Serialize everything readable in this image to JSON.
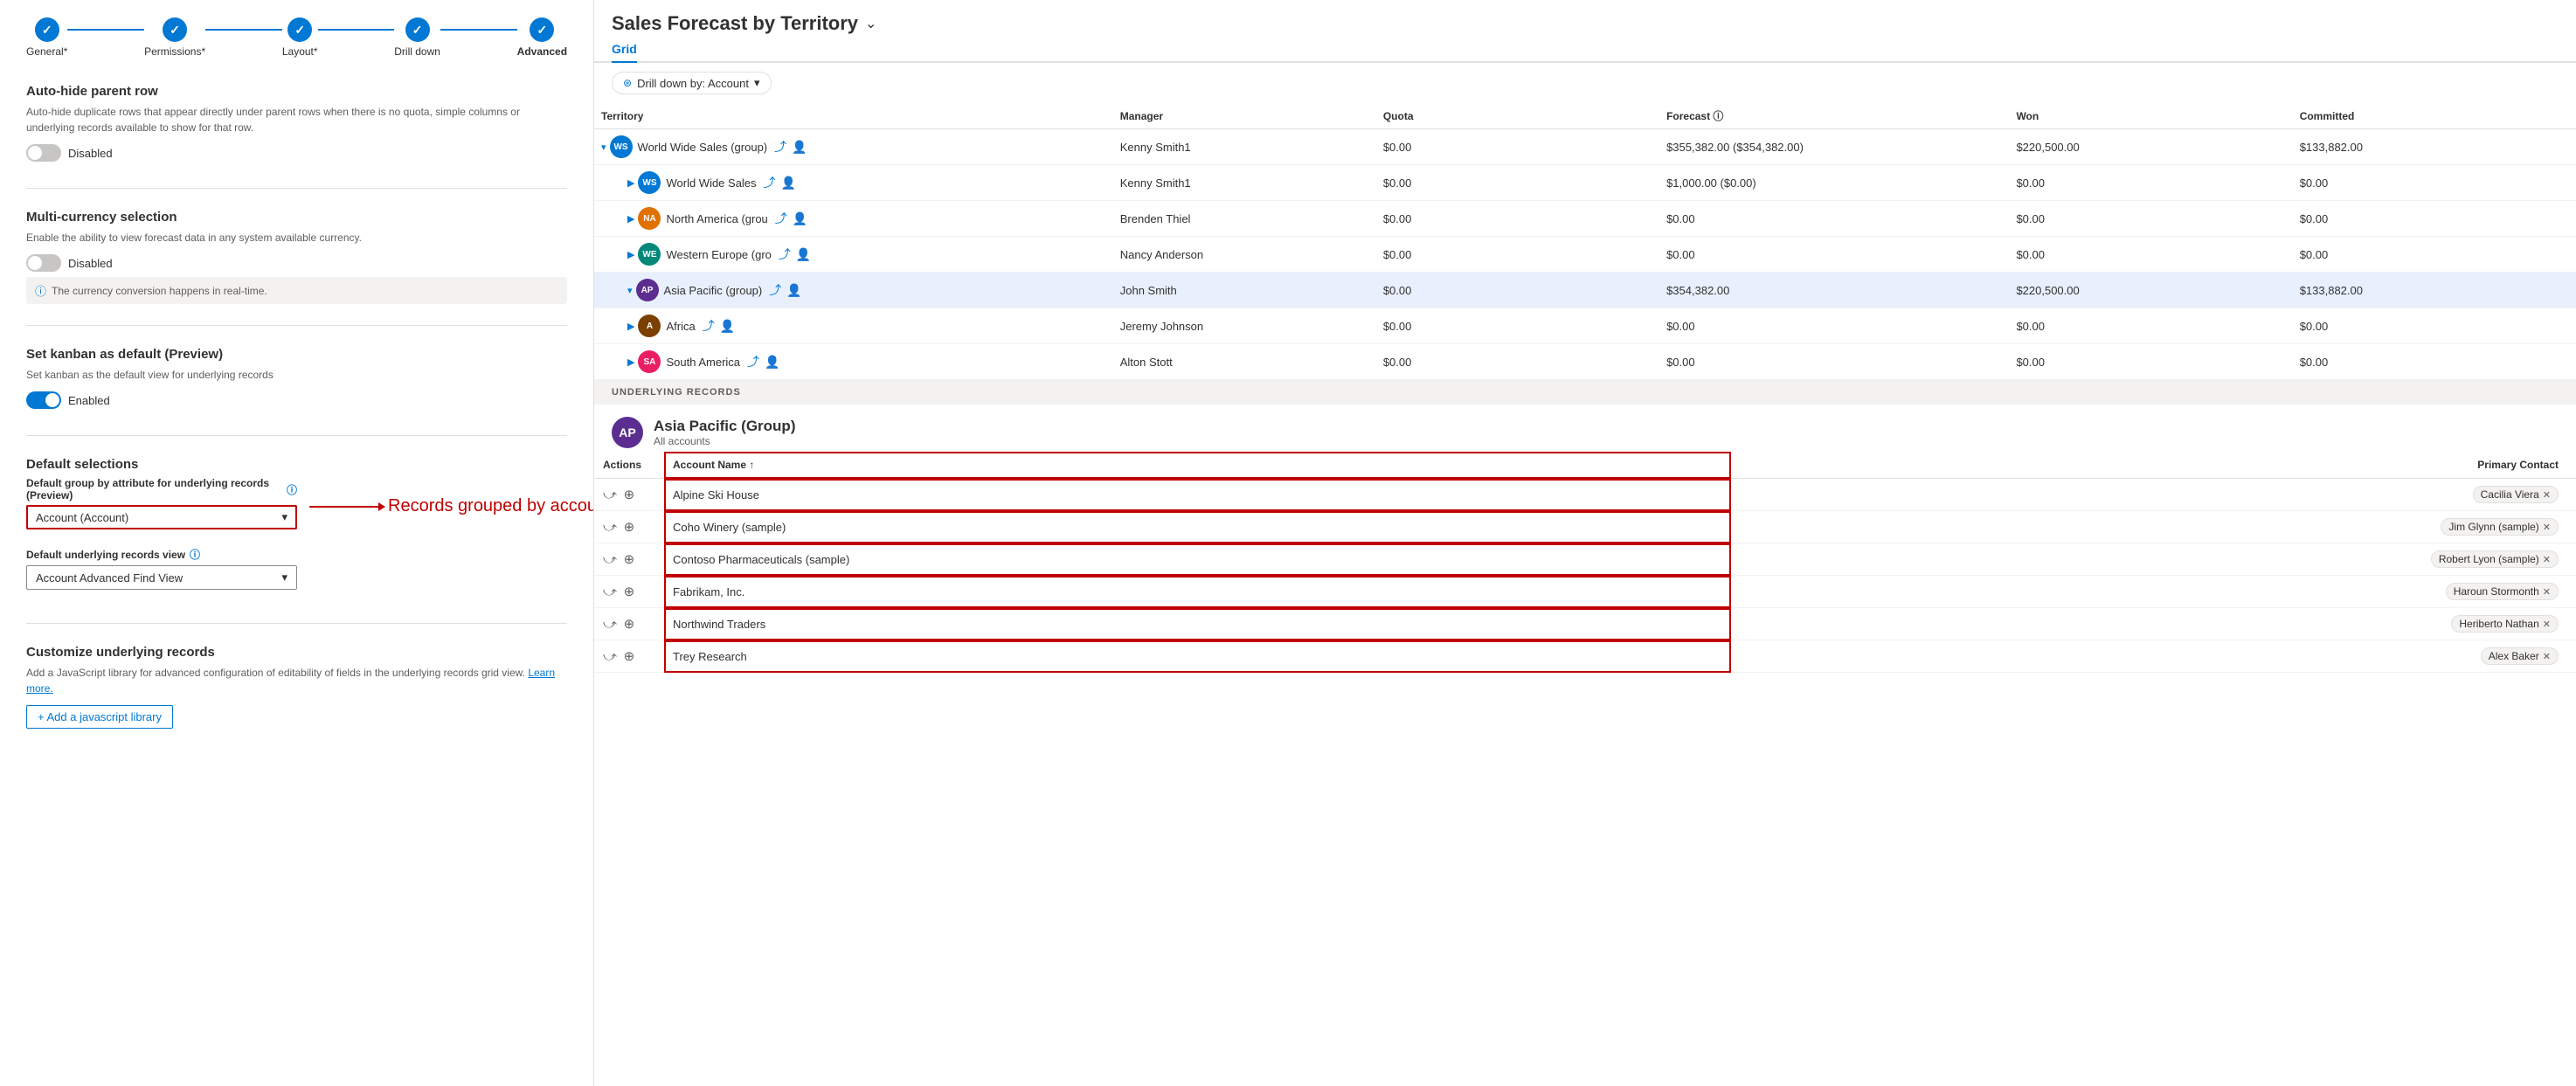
{
  "wizard": {
    "steps": [
      {
        "label": "General*",
        "icon": "✓",
        "active": false
      },
      {
        "label": "Permissions*",
        "icon": "✓",
        "active": false
      },
      {
        "label": "Layout*",
        "icon": "✓",
        "active": false
      },
      {
        "label": "Drill down",
        "icon": "✓",
        "active": false
      },
      {
        "label": "Advanced",
        "icon": "✓",
        "active": true
      }
    ]
  },
  "left": {
    "auto_hide": {
      "title": "Auto-hide parent row",
      "desc": "Auto-hide duplicate rows that appear directly under parent rows when there is no quota, simple columns or underlying records available to show for that row.",
      "toggle_state": "Disabled"
    },
    "multi_currency": {
      "title": "Multi-currency selection",
      "desc": "Enable the ability to view forecast data in any system available currency.",
      "toggle_state": "Disabled",
      "info_text": "The currency conversion happens in real-time."
    },
    "kanban": {
      "title": "Set kanban as default (Preview)",
      "desc": "Set kanban as the default view for underlying records",
      "toggle_state": "Enabled"
    },
    "default_selections": {
      "title": "Default selections",
      "group_label": "Default group by attribute for underlying records (Preview)",
      "group_value": "Account (Account)",
      "view_label": "Default underlying records view",
      "view_value": "Account Advanced Find View",
      "annotation": "Records grouped by account"
    },
    "customize": {
      "title": "Customize underlying records",
      "desc": "Add a JavaScript library for advanced configuration of editability of fields in the underlying records grid view.",
      "link_text": "Learn more.",
      "button_label": "+ Add a javascript library"
    }
  },
  "right": {
    "title": "Sales Forecast by Territory",
    "tab": "Grid",
    "drill_btn": "Drill down by: Account",
    "table": {
      "headers": [
        "Territory",
        "Manager",
        "Quota",
        "Forecast",
        "Won",
        "Committed"
      ],
      "rows": [
        {
          "level": 0,
          "expanded": true,
          "avatar_bg": "#0078d4",
          "avatar_text": "WS",
          "name": "World Wide Sales (group)",
          "manager": "Kenny Smith1",
          "quota": "$0.00",
          "forecast": "$355,382.00 ($354,382.00)",
          "won": "$220,500.00",
          "committed": "$133,882.00",
          "highlighted": false
        },
        {
          "level": 1,
          "expanded": false,
          "avatar_bg": "#0078d4",
          "avatar_text": "WS",
          "name": "World Wide Sales",
          "manager": "Kenny Smith1",
          "quota": "$0.00",
          "forecast": "$1,000.00 ($0.00)",
          "won": "$0.00",
          "committed": "$0.00",
          "highlighted": false
        },
        {
          "level": 1,
          "expanded": false,
          "avatar_bg": "#e07000",
          "avatar_text": "NA",
          "name": "North America (grou",
          "manager": "Brenden Thiel",
          "quota": "$0.00",
          "forecast": "$0.00",
          "won": "$0.00",
          "committed": "$0.00",
          "highlighted": false
        },
        {
          "level": 1,
          "expanded": false,
          "avatar_bg": "#00897b",
          "avatar_text": "WE",
          "name": "Western Europe (gro",
          "manager": "Nancy Anderson",
          "quota": "$0.00",
          "forecast": "$0.00",
          "won": "$0.00",
          "committed": "$0.00",
          "highlighted": false
        },
        {
          "level": 1,
          "expanded": true,
          "avatar_bg": "#5c2d91",
          "avatar_text": "AP",
          "name": "Asia Pacific (group)",
          "manager": "John Smith",
          "quota": "$0.00",
          "forecast": "$354,382.00",
          "won": "$220,500.00",
          "committed": "$133,882.00",
          "highlighted": true
        },
        {
          "level": 1,
          "expanded": false,
          "avatar_bg": "#7b3f00",
          "avatar_text": "A",
          "name": "Africa",
          "manager": "Jeremy Johnson",
          "quota": "$0.00",
          "forecast": "$0.00",
          "won": "$0.00",
          "committed": "$0.00",
          "highlighted": false
        },
        {
          "level": 1,
          "expanded": false,
          "avatar_bg": "#e91e63",
          "avatar_text": "SA",
          "name": "South America",
          "manager": "Alton Stott",
          "quota": "$0.00",
          "forecast": "$0.00",
          "won": "$0.00",
          "committed": "$0.00",
          "highlighted": false
        }
      ]
    },
    "underlying": {
      "header": "UNDERLYING RECORDS",
      "entity_avatar_bg": "#5c2d91",
      "entity_avatar_text": "AP",
      "entity_name": "Asia Pacific (Group)",
      "entity_sub": "All accounts",
      "table_headers": [
        "Actions",
        "Account Name ↑",
        "Primary Contact"
      ],
      "rows": [
        {
          "account": "Alpine Ski House",
          "contact": "Cacilia Viera"
        },
        {
          "account": "Coho Winery (sample)",
          "contact": "Jim Glynn (sample)"
        },
        {
          "account": "Contoso Pharmaceuticals (sample)",
          "contact": "Robert Lyon (sample)"
        },
        {
          "account": "Fabrikam, Inc.",
          "contact": "Haroun Stormonth"
        },
        {
          "account": "Northwind Traders",
          "contact": "Heriberto Nathan"
        },
        {
          "account": "Trey Research",
          "contact": "Alex Baker"
        }
      ]
    }
  }
}
